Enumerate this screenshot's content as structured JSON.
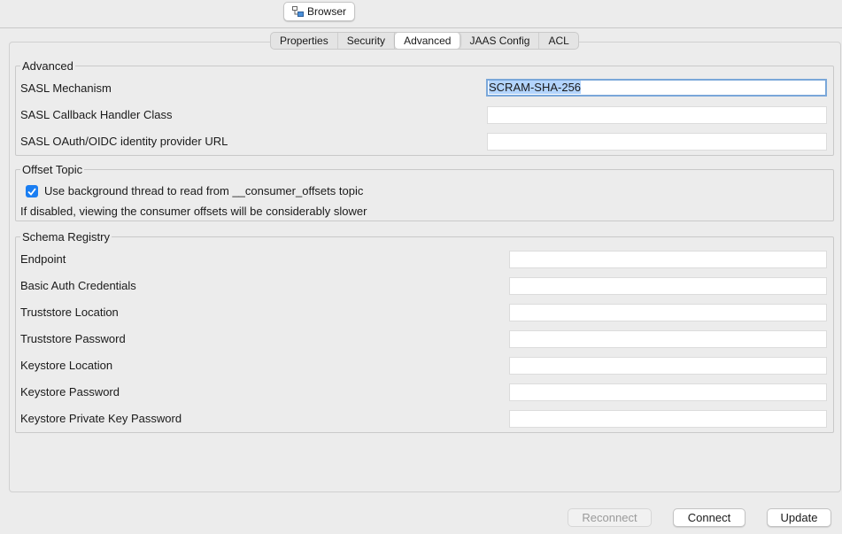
{
  "toolbar": {
    "browser_label": "Browser",
    "browser_icon": "browser-icon"
  },
  "tabs": [
    "Properties",
    "Security",
    "Advanced",
    "JAAS Config",
    "ACL"
  ],
  "active_tab": "Advanced",
  "advanced": {
    "title": "Advanced",
    "sasl_mechanism_label": "SASL Mechanism",
    "sasl_mechanism_value": "SCRAM-SHA-256",
    "sasl_callback_label": "SASL Callback Handler Class",
    "sasl_callback_value": "",
    "sasl_oauth_label": "SASL OAuth/OIDC identity provider URL",
    "sasl_oauth_value": ""
  },
  "offset_topic": {
    "title": "Offset Topic",
    "checkbox_label": "Use background thread to read from __consumer_offsets topic",
    "checked": true,
    "note": "If disabled, viewing the consumer offsets will be considerably slower"
  },
  "schema_registry": {
    "title": "Schema Registry",
    "fields": [
      {
        "label": "Endpoint",
        "value": ""
      },
      {
        "label": "Basic Auth Credentials",
        "value": ""
      },
      {
        "label": "Truststore Location",
        "value": ""
      },
      {
        "label": "Truststore Password",
        "value": ""
      },
      {
        "label": "Keystore Location",
        "value": ""
      },
      {
        "label": "Keystore Password",
        "value": ""
      },
      {
        "label": "Keystore Private Key Password",
        "value": ""
      }
    ]
  },
  "buttons": {
    "reconnect": "Reconnect",
    "connect": "Connect",
    "update": "Update"
  },
  "colors": {
    "accent": "#1a7ef2",
    "selection": "#b3d4fc",
    "focus_ring": "#7aa7d9"
  }
}
